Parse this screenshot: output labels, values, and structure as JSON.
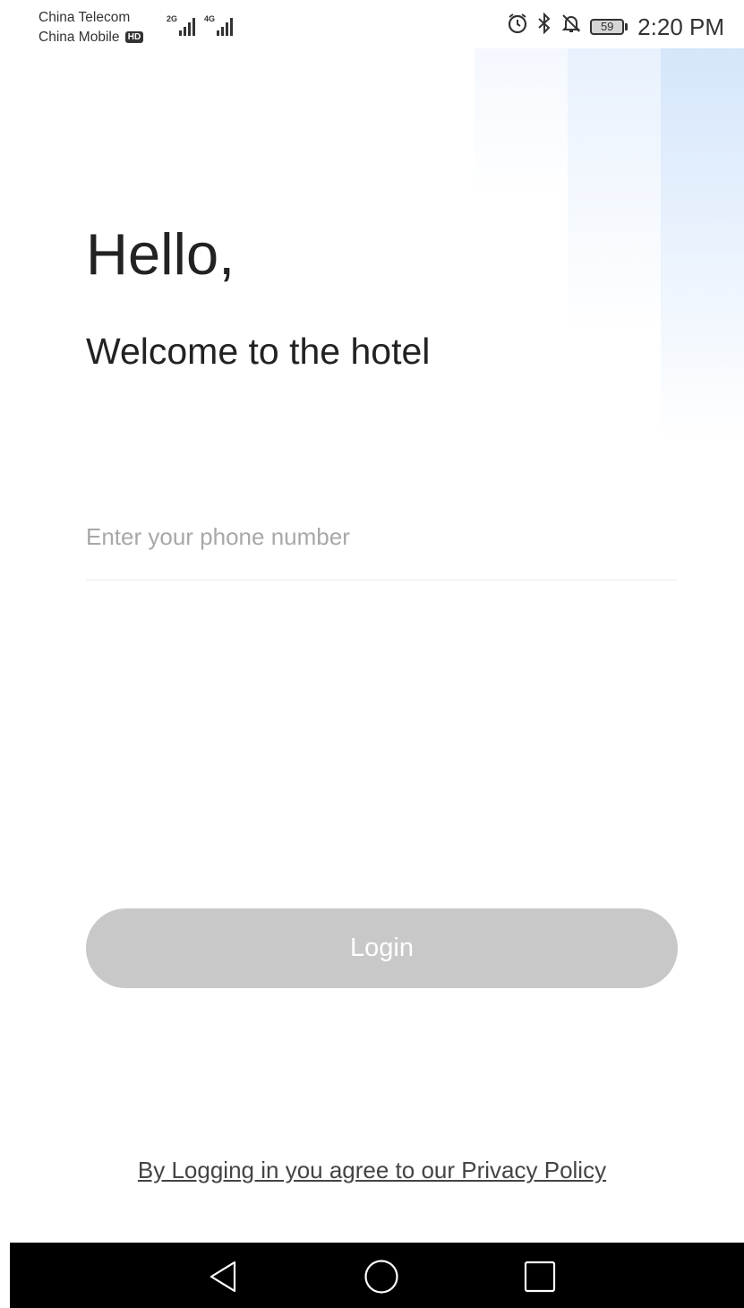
{
  "status_bar": {
    "carrier_1": "China Telecom",
    "carrier_2": "China Mobile",
    "hd_badge": "HD",
    "signal_1_tag": "2G",
    "signal_2_tag": "4G",
    "battery_level": "59",
    "time": "2:20 PM",
    "icons": [
      "alarm-icon",
      "bluetooth-icon",
      "notifications-off-icon",
      "battery-icon"
    ]
  },
  "greeting": {
    "title": "Hello,",
    "subtitle": "Welcome to the hotel"
  },
  "phone_input": {
    "placeholder": "Enter your phone number",
    "value": ""
  },
  "login_button": {
    "label": "Login",
    "enabled": false
  },
  "privacy": {
    "link_text": "By Logging in you agree to our Privacy Policy"
  },
  "nav_bar": {
    "buttons": [
      "back-icon",
      "home-icon",
      "recents-icon"
    ]
  },
  "colors": {
    "button_disabled": "#c8c8c8",
    "decor_blue": "#d5e6fb",
    "text": "#222222",
    "placeholder": "#a8a8a8"
  }
}
